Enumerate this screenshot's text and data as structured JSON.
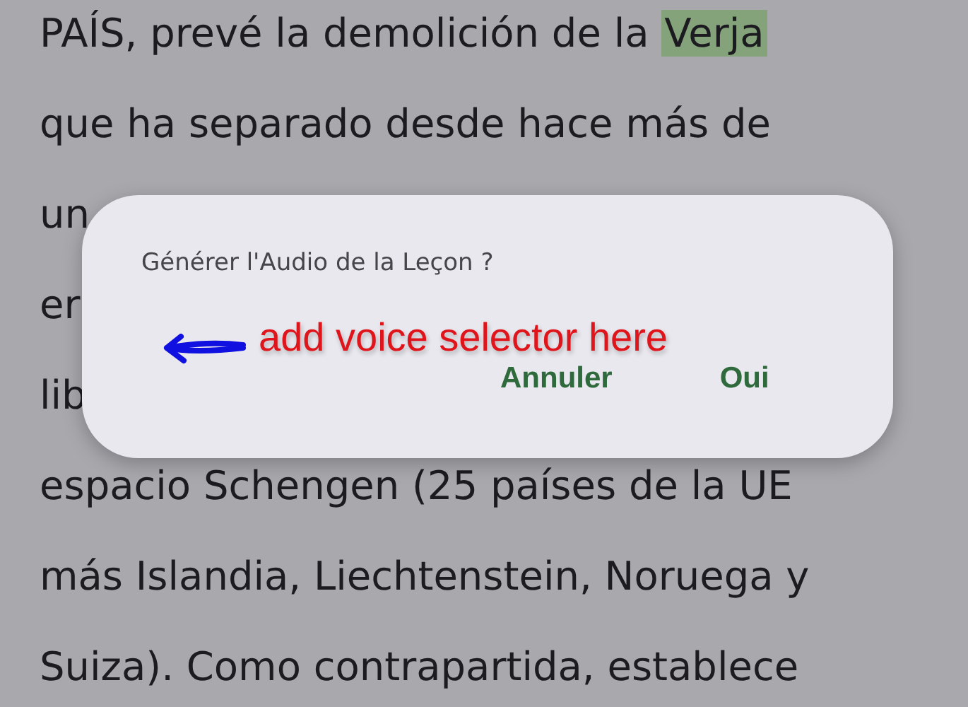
{
  "lesson_text": [
    {
      "segments": [
        {
          "text": "PAÍS, prevé la demolición de la ",
          "highlighted": false
        },
        {
          "text": "Verja",
          "highlighted": true
        }
      ]
    },
    {
      "segments": [
        {
          "text": "que ha separado desde hace más de",
          "highlighted": false
        }
      ]
    },
    {
      "segments": [
        {
          "text": "un",
          "highlighted": false
        }
      ]
    },
    {
      "segments": [
        {
          "text": "er",
          "highlighted": false
        }
      ]
    },
    {
      "segments": [
        {
          "text": "lib",
          "highlighted": false
        }
      ]
    },
    {
      "segments": [
        {
          "text": "espacio Schengen (25 países de la UE",
          "highlighted": false
        }
      ]
    },
    {
      "segments": [
        {
          "text": "más Islandia, Liechtenstein, Noruega y",
          "highlighted": false
        }
      ]
    },
    {
      "segments": [
        {
          "text": "Suiza). Como contrapartida, establece",
          "highlighted": false
        }
      ]
    }
  ],
  "dialog": {
    "title": "Générer l'Audio de la Leçon ?",
    "annotation": "add voice selector here",
    "buttons": [
      "Annuler",
      "Oui"
    ]
  }
}
